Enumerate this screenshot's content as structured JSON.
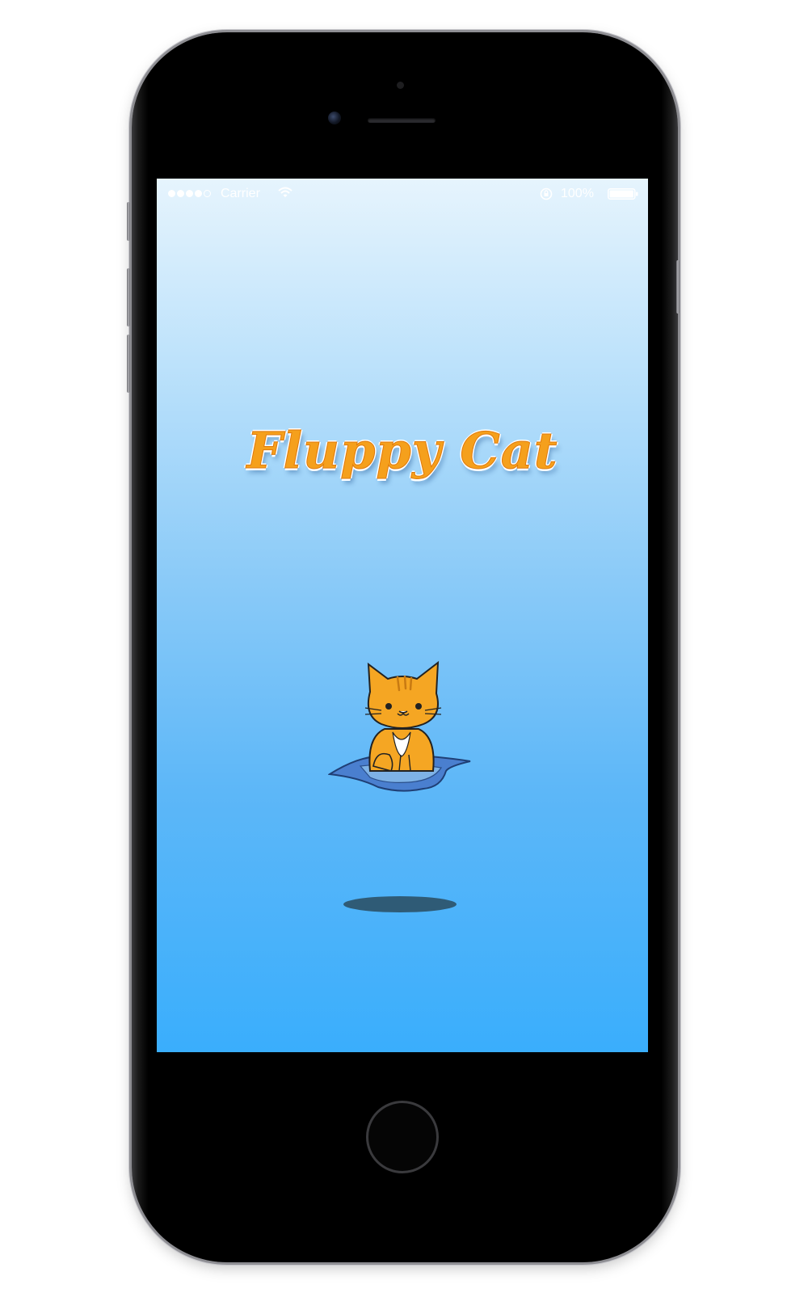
{
  "status_bar": {
    "carrier": "Carrier",
    "battery_percent": "100%"
  },
  "app": {
    "title": "Fluppy Cat"
  },
  "icons": {
    "signal": "signal-dots-icon",
    "wifi": "wifi-icon",
    "orientation_lock": "orientation-lock-icon",
    "battery": "battery-icon",
    "cat": "cat-on-cushion-icon"
  },
  "colors": {
    "sky_top": "#e6f4fd",
    "sky_bottom": "#3aaefc",
    "title_orange": "#f5a01c",
    "cat_orange": "#f5a623",
    "cushion_blue": "#4a7fcf",
    "shadow": "#2f5b76"
  }
}
